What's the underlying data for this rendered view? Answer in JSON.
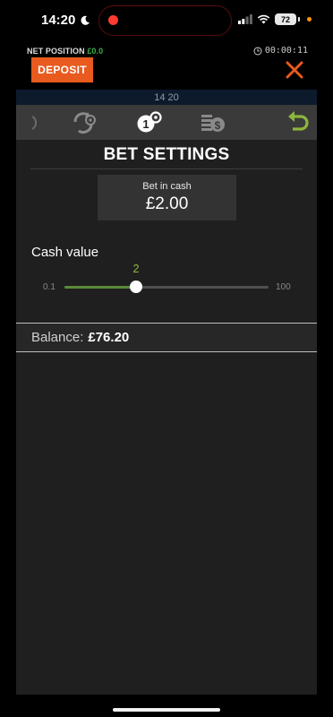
{
  "status_bar": {
    "time": "14:20",
    "battery": "72"
  },
  "header": {
    "net_position_label": "NET POSITION",
    "net_position_value": "£0.0",
    "timer": "00:00:11",
    "deposit_label": "DEPOSIT"
  },
  "game": {
    "top_time": "14 20",
    "title": "BET SETTINGS",
    "bet_box": {
      "label": "Bet in cash",
      "value": "£2.00"
    },
    "cash_value": {
      "label": "Cash value",
      "current": "2",
      "min": "0.1",
      "max": "100",
      "fill_percent": 35
    },
    "balance": {
      "label": "Balance:",
      "value": "£76.20"
    }
  },
  "colors": {
    "accent_orange": "#e95a1e",
    "accent_green": "#8cb63c",
    "net_value_green": "#3fb14a",
    "panel_bg": "#1f1f1f",
    "toolbar_bg": "#3a3a3a"
  },
  "icons": [
    "moon-icon",
    "signal-icon",
    "wifi-icon",
    "battery-icon",
    "clock-icon",
    "close-icon",
    "refresh-gears-icon",
    "bet-settings-icon",
    "coin-stack-icon",
    "back-arrow-icon"
  ]
}
